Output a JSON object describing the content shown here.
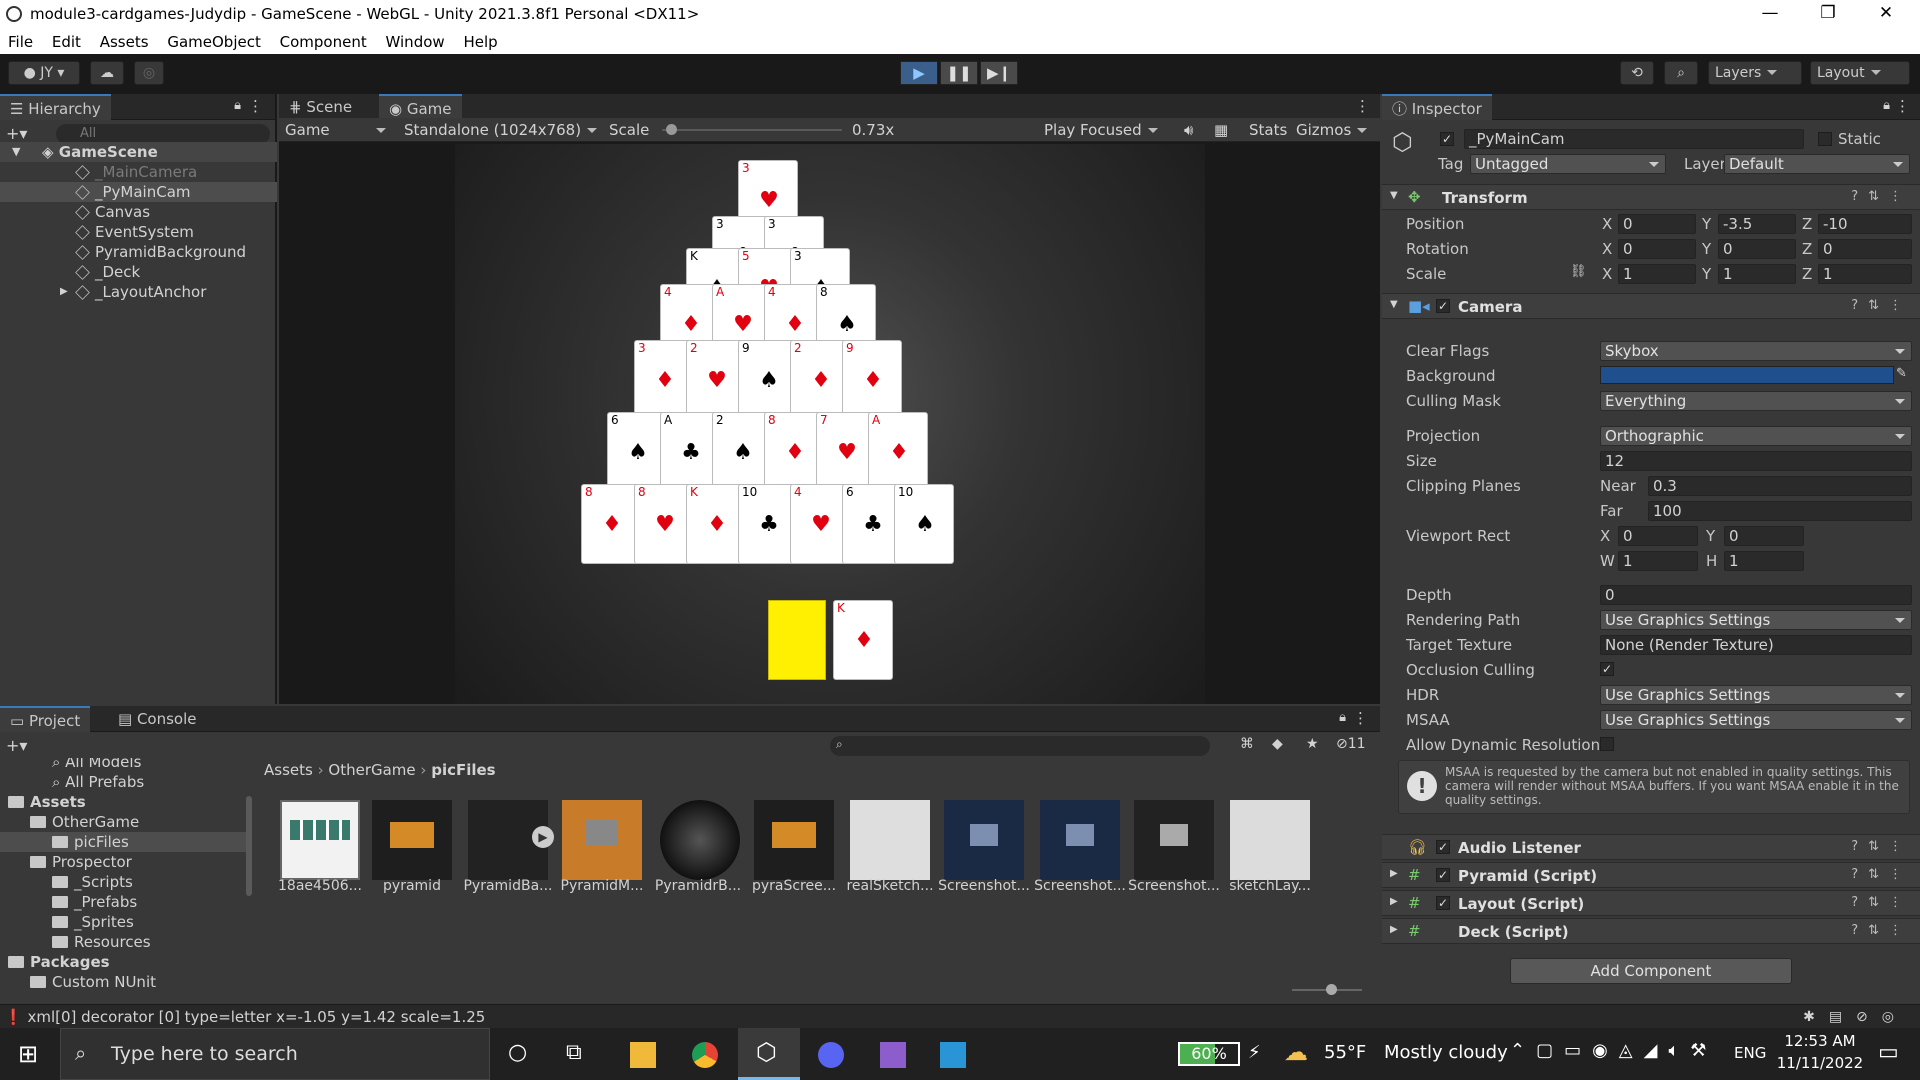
{
  "window": {
    "title": "module3-cardgames-Judydip - GameScene - WebGL - Unity 2021.3.8f1 Personal <DX11>",
    "controls": [
      "—",
      "❐",
      "✕"
    ]
  },
  "menu": [
    "File",
    "Edit",
    "Assets",
    "GameObject",
    "Component",
    "Window",
    "Help"
  ],
  "toolbar": {
    "account": "JY",
    "layers": "Layers",
    "layout": "Layout"
  },
  "hierarchy": {
    "tab": "Hierarchy",
    "search_placeholder": "All",
    "scene": "GameScene",
    "items": [
      "_MainCamera",
      "_PyMainCam",
      "Canvas",
      "EventSystem",
      "PyramidBackground",
      "_Deck",
      "_LayoutAnchor"
    ]
  },
  "game": {
    "tabs": [
      "Scene",
      "Game"
    ],
    "display": "Game",
    "resolution": "Standalone (1024x768)",
    "scale_label": "Scale",
    "scale_value": "0.73x",
    "scale_fraction": 0.05,
    "play_mode": "Play Focused",
    "stats": "Stats",
    "gizmos": "Gizmos",
    "cards": [
      {
        "row": 0,
        "rank": "3",
        "suit": "♥",
        "color": "red"
      },
      {
        "row": 1,
        "rank": "3",
        "suit": "♣",
        "color": "black"
      },
      {
        "row": 1,
        "rank": "3",
        "suit": "♣",
        "color": "black"
      },
      {
        "row": 2,
        "rank": "K",
        "suit": "♠",
        "color": "black"
      },
      {
        "row": 2,
        "rank": "5",
        "suit": "♥",
        "color": "red"
      },
      {
        "row": 2,
        "rank": "3",
        "suit": "♠",
        "color": "black"
      },
      {
        "row": 3,
        "rank": "4",
        "suit": "♦",
        "color": "red"
      },
      {
        "row": 3,
        "rank": "A",
        "suit": "♥",
        "color": "red"
      },
      {
        "row": 3,
        "rank": "4",
        "suit": "♦",
        "color": "red"
      },
      {
        "row": 3,
        "rank": "8",
        "suit": "♠",
        "color": "black"
      },
      {
        "row": 4,
        "rank": "3",
        "suit": "♦",
        "color": "red"
      },
      {
        "row": 4,
        "rank": "2",
        "suit": "♥",
        "color": "red"
      },
      {
        "row": 4,
        "rank": "9",
        "suit": "♠",
        "color": "black"
      },
      {
        "row": 4,
        "rank": "2",
        "suit": "♦",
        "color": "red"
      },
      {
        "row": 4,
        "rank": "9",
        "suit": "♦",
        "color": "red"
      },
      {
        "row": 5,
        "rank": "6",
        "suit": "♠",
        "color": "black"
      },
      {
        "row": 5,
        "rank": "A",
        "suit": "♣",
        "color": "black"
      },
      {
        "row": 5,
        "rank": "2",
        "suit": "♠",
        "color": "black"
      },
      {
        "row": 5,
        "rank": "8",
        "suit": "♦",
        "color": "red"
      },
      {
        "row": 5,
        "rank": "7",
        "suit": "♥",
        "color": "red"
      },
      {
        "row": 5,
        "rank": "A",
        "suit": "♦",
        "color": "red"
      },
      {
        "row": 6,
        "rank": "8",
        "suit": "♦",
        "color": "red"
      },
      {
        "row": 6,
        "rank": "8",
        "suit": "♥",
        "color": "red"
      },
      {
        "row": 6,
        "rank": "K",
        "suit": "♦",
        "color": "red"
      },
      {
        "row": 6,
        "rank": "10",
        "suit": "♣",
        "color": "black"
      },
      {
        "row": 6,
        "rank": "4",
        "suit": "♥",
        "color": "red"
      },
      {
        "row": 6,
        "rank": "6",
        "suit": "♣",
        "color": "black"
      },
      {
        "row": 6,
        "rank": "10",
        "suit": "♠",
        "color": "black"
      }
    ],
    "draw_card": {
      "rank": "K",
      "suit": "♦",
      "color": "red"
    },
    "deck_color": "#ffef00"
  },
  "inspector": {
    "tab": "Inspector",
    "object_name": "_PyMainCam",
    "static_label": "Static",
    "tag_label": "Tag",
    "tag": "Untagged",
    "layer_label": "Layer",
    "layer": "Default",
    "transform": {
      "title": "Transform",
      "position": {
        "label": "Position",
        "x": "0",
        "y": "-3.5",
        "z": "-10"
      },
      "rotation": {
        "label": "Rotation",
        "x": "0",
        "y": "0",
        "z": "0"
      },
      "scale": {
        "label": "Scale",
        "x": "1",
        "y": "1",
        "z": "1"
      }
    },
    "camera": {
      "title": "Camera",
      "clear_flags": {
        "label": "Clear Flags",
        "value": "Skybox"
      },
      "background": {
        "label": "Background",
        "color": "#1f4f8c"
      },
      "culling_mask": {
        "label": "Culling Mask",
        "value": "Everything"
      },
      "projection": {
        "label": "Projection",
        "value": "Orthographic"
      },
      "size": {
        "label": "Size",
        "value": "12"
      },
      "clipping": {
        "label": "Clipping Planes",
        "near_label": "Near",
        "near": "0.3",
        "far_label": "Far",
        "far": "100"
      },
      "viewport": {
        "label": "Viewport Rect",
        "x": "0",
        "y": "0",
        "w": "1",
        "h": "1"
      },
      "depth": {
        "label": "Depth",
        "value": "0"
      },
      "rendering_path": {
        "label": "Rendering Path",
        "value": "Use Graphics Settings"
      },
      "target_texture": {
        "label": "Target Texture",
        "value": "None (Render Texture)"
      },
      "occlusion": {
        "label": "Occlusion Culling"
      },
      "hdr": {
        "label": "HDR",
        "value": "Use Graphics Settings"
      },
      "msaa": {
        "label": "MSAA",
        "value": "Use Graphics Settings"
      },
      "dynamic_res": {
        "label": "Allow Dynamic Resolution"
      },
      "warning": "MSAA is requested by the camera but not enabled in quality settings. This camera will render without MSAA buffers. If you want MSAA enable it in the quality settings."
    },
    "components": [
      "Audio Listener",
      "Pyramid (Script)",
      "Layout (Script)",
      "Deck (Script)"
    ],
    "add_component": "Add Component"
  },
  "project": {
    "tabs": [
      "Project",
      "Console"
    ],
    "hidden_count": "11",
    "tree": [
      {
        "label": "All Models",
        "indent": 2,
        "type": "search"
      },
      {
        "label": "All Prefabs",
        "indent": 2,
        "type": "search"
      },
      {
        "label": "Assets",
        "indent": 0,
        "type": "folder",
        "bold": true
      },
      {
        "label": "OtherGame",
        "indent": 1,
        "type": "folder"
      },
      {
        "label": "picFiles",
        "indent": 2,
        "type": "folder"
      },
      {
        "label": "Prospector",
        "indent": 1,
        "type": "folder"
      },
      {
        "label": "_Scripts",
        "indent": 2,
        "type": "folder"
      },
      {
        "label": "_Prefabs",
        "indent": 2,
        "type": "folder"
      },
      {
        "label": "_Sprites",
        "indent": 2,
        "type": "folder"
      },
      {
        "label": "Resources",
        "indent": 2,
        "type": "folder"
      },
      {
        "label": "Packages",
        "indent": 0,
        "type": "folder",
        "bold": true
      },
      {
        "label": "Custom NUnit",
        "indent": 1,
        "type": "folder"
      }
    ],
    "breadcrumb": [
      "Assets",
      "OtherGame",
      "picFiles"
    ],
    "assets": [
      "18ae4506...",
      "pyramid",
      "PyramidBa...",
      "PyramidM...",
      "PyramidrB...",
      "pyraScree...",
      "realSketch...",
      "Screenshot...",
      "Screenshot...",
      "Screenshot...",
      "sketchLay..."
    ]
  },
  "status": "xml[0] decorator [0] type=letter x=-1.05 y=1.42 scale=1.25",
  "taskbar": {
    "search": "Type here to search",
    "battery": "60%",
    "weather_temp": "55°F",
    "weather": "Mostly cloudy",
    "lang": "ENG",
    "time": "12:53 AM",
    "date": "11/11/2022"
  }
}
